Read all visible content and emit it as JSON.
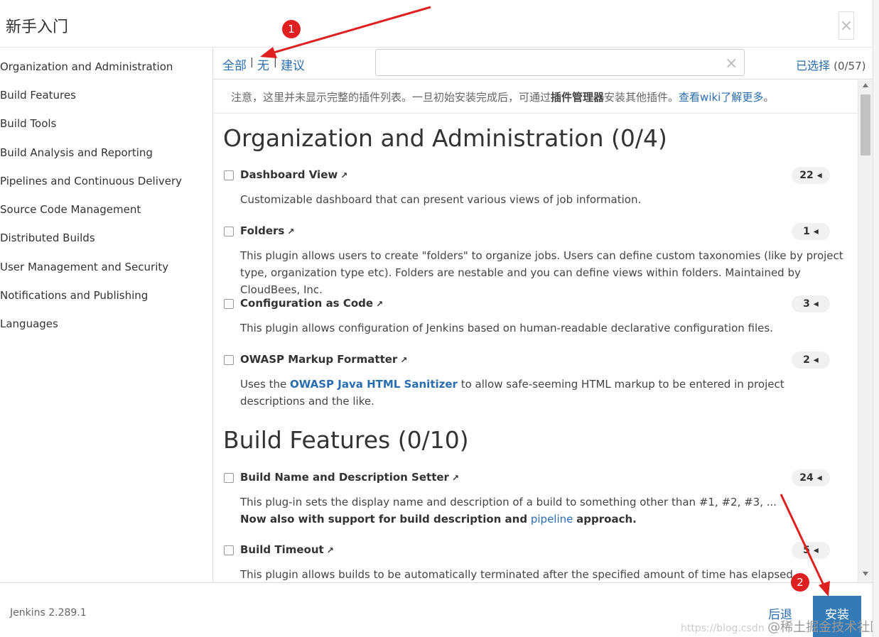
{
  "dialog": {
    "title": "新手入门",
    "close_label": "×"
  },
  "sidebar": {
    "items": [
      "Organization and Administration",
      "Build Features",
      "Build Tools",
      "Build Analysis and Reporting",
      "Pipelines and Continuous Delivery",
      "Source Code Management",
      "Distributed Builds",
      "User Management and Security",
      "Notifications and Publishing",
      "Languages"
    ]
  },
  "toolbar": {
    "select_all": "全部",
    "select_none": "无",
    "select_suggested": "建议",
    "separator": "|",
    "search_value": "",
    "clear_label": "×",
    "selected_label": "已选择",
    "selected_count": "(0/57)"
  },
  "notice": {
    "before": "注意，这里并未显示完整的插件列表。一旦初始安装完成后，可通过",
    "bold": "插件管理器",
    "middle": "安装其他插件。",
    "link": "查看wiki了解更多",
    "end": "。"
  },
  "sections": [
    {
      "title": "Organization and Administration (0/4)",
      "plugins": [
        {
          "name": "Dashboard View",
          "deps": "22",
          "desc": "Customizable dashboard that can present various views of job information."
        },
        {
          "name": "Folders",
          "deps": "1",
          "desc": "This plugin allows users to create \"folders\" to organize jobs. Users can define custom taxonomies (like by project type, organization type etc). Folders are nestable and you can define views within folders. Maintained by CloudBees, Inc."
        },
        {
          "name": "Configuration as Code",
          "deps": "3",
          "desc": "This plugin allows configuration of Jenkins based on human-readable declarative configuration files."
        },
        {
          "name": "OWASP Markup Formatter",
          "deps": "2",
          "desc_before": "Uses the ",
          "desc_link": "OWASP Java HTML Sanitizer",
          "desc_after": " to allow safe-seeming HTML markup to be entered in project descriptions and the like."
        }
      ]
    },
    {
      "title": "Build Features (0/10)",
      "plugins": [
        {
          "name": "Build Name and Description Setter",
          "deps": "24",
          "desc": "This plug-in sets the display name and description of a build to something other than #1, #2, #3, ...",
          "desc_bold": "Now also with support for build description and",
          "desc_link": "pipeline",
          "desc_bold_end": "approach."
        },
        {
          "name": "Build Timeout",
          "deps": "5",
          "desc": "This plugin allows builds to be automatically terminated after the specified amount of time has elapsed."
        }
      ]
    }
  ],
  "footer": {
    "version": "Jenkins 2.289.1",
    "back_label": "后退",
    "install_label": "安装",
    "watermark_url": "https://blog.csdn",
    "watermark_brand": "@稀土掘金技术社区"
  },
  "annotations": {
    "marker_1": "1",
    "marker_2": "2",
    "color": "#e02020"
  },
  "icons": {
    "external_link": "external-link-icon",
    "dependency_caret": "caret-left-icon"
  }
}
